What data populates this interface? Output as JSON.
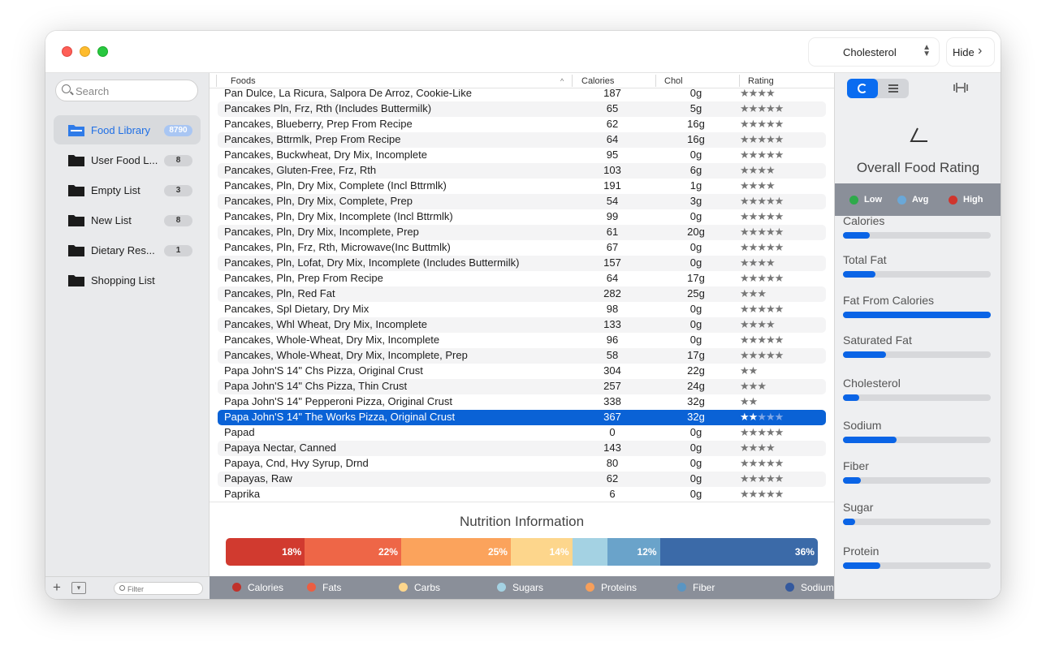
{
  "titlebar": {
    "sort_value": "Cholesterol",
    "hide_label": "Hide"
  },
  "sidebar": {
    "search_placeholder": "Search",
    "filter_placeholder": "Filter",
    "items": [
      {
        "label": "Food Library",
        "count": "8790",
        "active": true
      },
      {
        "label": "User Food L...",
        "count": "8"
      },
      {
        "label": "Empty List",
        "count": "3"
      },
      {
        "label": "New List",
        "count": "8"
      },
      {
        "label": "Dietary Res...",
        "count": "1"
      },
      {
        "label": "Shopping List",
        "count": ""
      }
    ]
  },
  "table": {
    "headers": {
      "foods": "Foods",
      "calories": "Calories",
      "chol": "Chol",
      "rating": "Rating"
    },
    "rows": [
      {
        "name": "Pan Dulce, La Ricura, Salpora De Arroz, Cookie-Like",
        "cal": "187",
        "chol": "0g",
        "stars": 4
      },
      {
        "name": "Pancakes Pln, Frz, Rth (Includes Buttermilk)",
        "cal": "65",
        "chol": "5g",
        "stars": 5
      },
      {
        "name": "Pancakes, Blueberry, Prep From Recipe",
        "cal": "62",
        "chol": "16g",
        "stars": 5
      },
      {
        "name": "Pancakes, Bttrmlk, Prep From Recipe",
        "cal": "64",
        "chol": "16g",
        "stars": 5
      },
      {
        "name": "Pancakes, Buckwheat, Dry Mix, Incomplete",
        "cal": "95",
        "chol": "0g",
        "stars": 5
      },
      {
        "name": "Pancakes, Gluten-Free, Frz, Rth",
        "cal": "103",
        "chol": "6g",
        "stars": 4
      },
      {
        "name": "Pancakes, Pln, Dry Mix, Complete (Incl Bttrmlk)",
        "cal": "191",
        "chol": "1g",
        "stars": 4
      },
      {
        "name": "Pancakes, Pln, Dry Mix, Complete, Prep",
        "cal": "54",
        "chol": "3g",
        "stars": 5
      },
      {
        "name": "Pancakes, Pln, Dry Mix, Incomplete (Incl Bttrmlk)",
        "cal": "99",
        "chol": "0g",
        "stars": 5
      },
      {
        "name": "Pancakes, Pln, Dry Mix, Incomplete, Prep",
        "cal": "61",
        "chol": "20g",
        "stars": 5
      },
      {
        "name": "Pancakes, Pln, Frz, Rth, Microwave(Inc Buttmlk)",
        "cal": "67",
        "chol": "0g",
        "stars": 5
      },
      {
        "name": "Pancakes, Pln, Lofat, Dry Mix, Incomplete (Includes Buttermilk)",
        "cal": "157",
        "chol": "0g",
        "stars": 4
      },
      {
        "name": "Pancakes, Pln, Prep From Recipe",
        "cal": "64",
        "chol": "17g",
        "stars": 5
      },
      {
        "name": "Pancakes, Pln, Red Fat",
        "cal": "282",
        "chol": "25g",
        "stars": 3
      },
      {
        "name": "Pancakes, Spl Dietary, Dry Mix",
        "cal": "98",
        "chol": "0g",
        "stars": 5
      },
      {
        "name": "Pancakes, Whl Wheat, Dry Mix, Incomplete",
        "cal": "133",
        "chol": "0g",
        "stars": 4
      },
      {
        "name": "Pancakes, Whole-Wheat, Dry Mix, Incomplete",
        "cal": "96",
        "chol": "0g",
        "stars": 5
      },
      {
        "name": "Pancakes, Whole-Wheat, Dry Mix, Incomplete, Prep",
        "cal": "58",
        "chol": "17g",
        "stars": 5
      },
      {
        "name": "Papa John'S 14\" Chs Pizza, Original Crust",
        "cal": "304",
        "chol": "22g",
        "stars": 2
      },
      {
        "name": "Papa John'S 14\" Chs Pizza, Thin Crust",
        "cal": "257",
        "chol": "24g",
        "stars": 3
      },
      {
        "name": "Papa John'S 14\" Pepperoni Pizza, Original Crust",
        "cal": "338",
        "chol": "32g",
        "stars": 2
      },
      {
        "name": "Papa John'S 14\" The Works Pizza, Original Crust",
        "cal": "367",
        "chol": "32g",
        "stars": 2,
        "selected": true
      },
      {
        "name": "Papad",
        "cal": "0",
        "chol": "0g",
        "stars": 5
      },
      {
        "name": "Papaya Nectar, Canned",
        "cal": "143",
        "chol": "0g",
        "stars": 4
      },
      {
        "name": "Papaya, Cnd, Hvy Syrup, Drnd",
        "cal": "80",
        "chol": "0g",
        "stars": 5
      },
      {
        "name": "Papayas, Raw",
        "cal": "62",
        "chol": "0g",
        "stars": 5
      },
      {
        "name": "Paprika",
        "cal": "6",
        "chol": "0g",
        "stars": 5
      }
    ]
  },
  "nutrition": {
    "title": "Nutrition Information",
    "segments": [
      {
        "label": "18%",
        "value": 18,
        "color": "#d13a2f"
      },
      {
        "label": "22%",
        "value": 22,
        "color": "#ee6647"
      },
      {
        "label": "25%",
        "value": 25,
        "color": "#fba35c"
      },
      {
        "label": "14%",
        "value": 14,
        "color": "#fdd68c"
      },
      {
        "label": "",
        "value": 8,
        "color": "#a4d2e3"
      },
      {
        "label": "12%",
        "value": 12,
        "color": "#6aa3ca"
      },
      {
        "label": "36%",
        "value": 36,
        "color": "#3b6aa8"
      }
    ],
    "legend": [
      {
        "label": "Calories",
        "color": "#c0322b"
      },
      {
        "label": "Fats",
        "color": "#ec5e42"
      },
      {
        "label": "Carbs",
        "color": "#fdd68c"
      },
      {
        "label": "Sugars",
        "color": "#a4d2e3"
      },
      {
        "label": "Proteins",
        "color": "#f79f5a"
      },
      {
        "label": "Fiber",
        "color": "#5a95c2"
      },
      {
        "label": "Sodium",
        "color": "#34599e"
      }
    ]
  },
  "rating_panel": {
    "title": "Overall Food Rating",
    "legend": [
      {
        "label": "Low",
        "color": "#2eaa4a"
      },
      {
        "label": "Avg",
        "color": "#6aa8d8"
      },
      {
        "label": "High",
        "color": "#d0352d"
      }
    ],
    "metrics": [
      {
        "label": "Calories",
        "level": 0.18
      },
      {
        "label": "Total Fat",
        "level": 0.22
      },
      {
        "label": "Fat From Calories",
        "level": 1.0
      },
      {
        "label": "Saturated Fat",
        "level": 0.29
      },
      {
        "label": "Cholesterol",
        "level": 0.11
      },
      {
        "label": "Sodium",
        "level": 0.36
      },
      {
        "label": "Fiber",
        "level": 0.12
      },
      {
        "label": "Sugar",
        "level": 0.08
      },
      {
        "label": "Protein",
        "level": 0.25
      }
    ]
  }
}
